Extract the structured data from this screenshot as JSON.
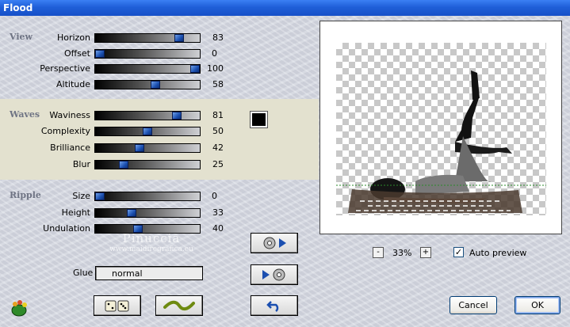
{
  "window": {
    "title": "Flood"
  },
  "sections": {
    "view": {
      "label": "View",
      "rows": [
        {
          "label": "Horizon",
          "value": 83
        },
        {
          "label": "Offset",
          "value": 0
        },
        {
          "label": "Perspective",
          "value": 100
        },
        {
          "label": "Altitude",
          "value": 58
        }
      ]
    },
    "waves": {
      "label": "Waves",
      "rows": [
        {
          "label": "Waviness",
          "value": 81
        },
        {
          "label": "Complexity",
          "value": 50
        },
        {
          "label": "Brilliance",
          "value": 42
        },
        {
          "label": "Blur",
          "value": 25
        }
      ]
    },
    "ripple": {
      "label": "Ripple",
      "rows": [
        {
          "label": "Size",
          "value": 0
        },
        {
          "label": "Height",
          "value": 33
        },
        {
          "label": "Undulation",
          "value": 40
        }
      ]
    }
  },
  "waves_color": "#000000",
  "watermark": {
    "name": "Pinuccia",
    "url": "www.maidiregrafica.eu"
  },
  "glue": {
    "label": "Glue",
    "value": "normal"
  },
  "zoom": {
    "value": "33%",
    "minus": "-",
    "plus": "+"
  },
  "auto_preview": {
    "label": "Auto preview",
    "checked": true
  },
  "buttons": {
    "cancel": "Cancel",
    "ok": "OK"
  },
  "colors": {
    "title_bar": "#1f5fd8",
    "section_label": "#6f7484",
    "waves_band": "#e3e1cf",
    "slider_thumb": "#1b4fb0"
  }
}
